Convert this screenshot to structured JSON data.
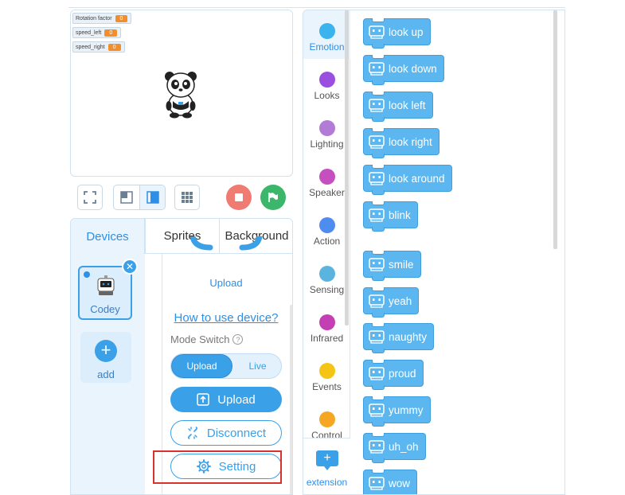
{
  "stage": {
    "variables": [
      {
        "name": "Rotation factor",
        "value": "0"
      },
      {
        "name": "speed_left",
        "value": "0"
      },
      {
        "name": "speed_right",
        "value": "0"
      }
    ],
    "sprite_icon": "panda-sprite-icon"
  },
  "stage_controls": {
    "fullscreen_icon": "fullscreen-icon",
    "small_stage_icon": "small-stage-icon",
    "normal_stage_icon": "normal-stage-icon",
    "grid_icon": "grid-icon",
    "stop_icon": "stop-icon",
    "go_icon": "green-flag-icon",
    "stop_color": "#ef7b72",
    "go_color": "#3bb66b"
  },
  "device_panel": {
    "tabs": [
      {
        "label": "Devices",
        "active": true
      },
      {
        "label": "Sprites",
        "active": false
      },
      {
        "label": "Background",
        "active": false
      }
    ],
    "device": {
      "name": "Codey",
      "icon": "codey-robot-icon"
    },
    "add_label": "add",
    "upload_caption": "Upload",
    "how_to": "How to use device?",
    "mode_switch_label": "Mode Switch",
    "mode_options": [
      {
        "label": "Upload",
        "selected": true
      },
      {
        "label": "Live",
        "selected": false
      }
    ],
    "upload_button": "Upload",
    "disconnect_button": "Disconnect",
    "setting_button": "Setting"
  },
  "categories": [
    {
      "label": "Emotion",
      "color": "#3ab3ee",
      "active": true
    },
    {
      "label": "Looks",
      "color": "#9a4fe0",
      "active": false
    },
    {
      "label": "Lighting",
      "color": "#b27bd6",
      "active": false
    },
    {
      "label": "Speaker",
      "color": "#c64fc0",
      "active": false
    },
    {
      "label": "Action",
      "color": "#4f8cf0",
      "active": false
    },
    {
      "label": "Sensing",
      "color": "#5ab4de",
      "active": false
    },
    {
      "label": "Infrared",
      "color": "#c43fb4",
      "active": false
    },
    {
      "label": "Events",
      "color": "#f5c516",
      "active": false
    },
    {
      "label": "Control",
      "color": "#f5a623",
      "active": false
    }
  ],
  "extension_label": "extension",
  "blocks": [
    "look up",
    "look down",
    "look left",
    "look right",
    "look around",
    "blink",
    "smile",
    "yeah",
    "naughty",
    "proud",
    "yummy",
    "uh_oh",
    "wow"
  ]
}
